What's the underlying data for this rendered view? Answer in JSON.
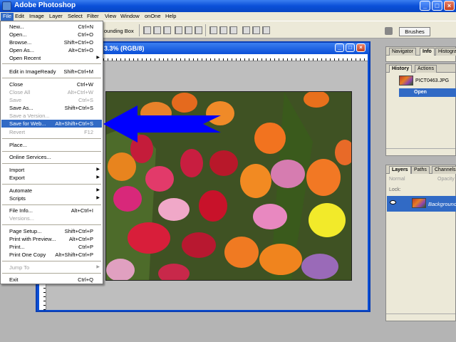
{
  "app": {
    "title": "Adobe Photoshop"
  },
  "window_controls": {
    "minimize": "_",
    "maximize": "□",
    "close": "×"
  },
  "menubar": [
    "File",
    "Edit",
    "Image",
    "Layer",
    "Select",
    "Filter",
    "View",
    "Window",
    "onOne",
    "Help"
  ],
  "options_bar": {
    "bounding_box_label": "ounding Box",
    "brushes_tab": "Brushes"
  },
  "document": {
    "title": "3.3% (RGB/8)"
  },
  "file_menu": {
    "items": [
      {
        "label": "New...",
        "shortcut": "Ctrl+N",
        "state": "enabled"
      },
      {
        "label": "Open...",
        "shortcut": "Ctrl+O",
        "state": "enabled"
      },
      {
        "label": "Browse...",
        "shortcut": "Shift+Ctrl+O",
        "state": "enabled"
      },
      {
        "label": "Open As...",
        "shortcut": "Alt+Ctrl+O",
        "state": "enabled"
      },
      {
        "label": "Open Recent",
        "shortcut": "",
        "state": "submenu"
      },
      {
        "label": "Edit in ImageReady",
        "shortcut": "Shift+Ctrl+M",
        "state": "enabled"
      },
      {
        "label": "Close",
        "shortcut": "Ctrl+W",
        "state": "enabled"
      },
      {
        "label": "Close All",
        "shortcut": "Alt+Ctrl+W",
        "state": "disabled"
      },
      {
        "label": "Save",
        "shortcut": "Ctrl+S",
        "state": "disabled"
      },
      {
        "label": "Save As...",
        "shortcut": "Shift+Ctrl+S",
        "state": "enabled"
      },
      {
        "label": "Save a Version...",
        "shortcut": "",
        "state": "disabled"
      },
      {
        "label": "Save for Web...",
        "shortcut": "Alt+Shift+Ctrl+S",
        "state": "active"
      },
      {
        "label": "Revert",
        "shortcut": "F12",
        "state": "disabled"
      },
      {
        "label": "Place...",
        "shortcut": "",
        "state": "enabled"
      },
      {
        "label": "Online Services...",
        "shortcut": "",
        "state": "enabled"
      },
      {
        "label": "Import",
        "shortcut": "",
        "state": "submenu"
      },
      {
        "label": "Export",
        "shortcut": "",
        "state": "submenu"
      },
      {
        "label": "Automate",
        "shortcut": "",
        "state": "submenu"
      },
      {
        "label": "Scripts",
        "shortcut": "",
        "state": "submenu"
      },
      {
        "label": "File Info...",
        "shortcut": "Alt+Ctrl+I",
        "state": "enabled"
      },
      {
        "label": "Versions...",
        "shortcut": "",
        "state": "disabled"
      },
      {
        "label": "Page Setup...",
        "shortcut": "Shift+Ctrl+P",
        "state": "enabled"
      },
      {
        "label": "Print with Preview...",
        "shortcut": "Alt+Ctrl+P",
        "state": "enabled"
      },
      {
        "label": "Print...",
        "shortcut": "Ctrl+P",
        "state": "enabled"
      },
      {
        "label": "Print One Copy",
        "shortcut": "Alt+Shift+Ctrl+P",
        "state": "enabled"
      },
      {
        "label": "Jump To",
        "shortcut": "",
        "state": "disabled-submenu"
      },
      {
        "label": "Exit",
        "shortcut": "Ctrl+Q",
        "state": "enabled"
      }
    ]
  },
  "nav_panel": {
    "tabs": [
      "Navigator",
      "Info",
      "Histogra"
    ]
  },
  "history_panel": {
    "tabs": [
      "History",
      "Actions"
    ],
    "snapshot": "PICT0463.JPG",
    "states": [
      "Open"
    ]
  },
  "layers_panel": {
    "tabs": [
      "Layers",
      "Paths",
      "Channels"
    ],
    "blend_mode": "Normal",
    "opacity_label": "Opacity",
    "lock_label": "Lock:",
    "layer_name": "Background"
  },
  "colors": {
    "accent": "#316ac5",
    "arrow": "#0000ff",
    "titlebar": "#0a4fd8"
  }
}
